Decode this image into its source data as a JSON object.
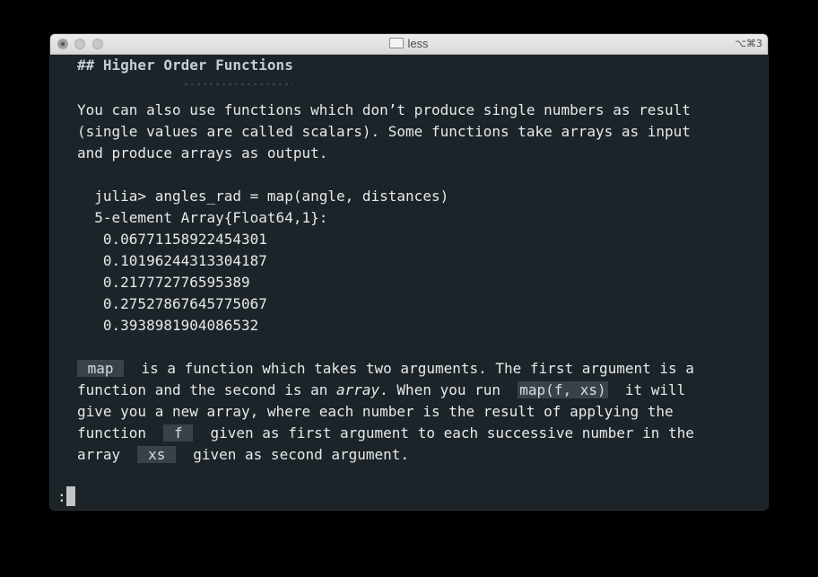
{
  "window": {
    "title": "less",
    "shortcut": "⌥⌘3"
  },
  "content": {
    "heading": "## Higher Order Functions",
    "para1_line1": "You can also use functions which don’t produce single numbers as result",
    "para1_line2": "(single values are called scalars). Some functions take arrays as input",
    "para1_line3": "and produce arrays as output.",
    "code_line1": "  julia> angles_rad = map(angle, distances)",
    "code_line2": "  5-element Array{Float64,1}:",
    "code_values": [
      "   0.06771158922454301",
      "   0.10196244313304187",
      "   0.217772776595389",
      "   0.27527867645775067",
      "   0.3938981904086532"
    ],
    "para2": {
      "l1_code": " map ",
      "l1_text": "  is a function which takes two arguments. The first argument is a",
      "l2_text_a": "function and the second is an ",
      "l2_em": "array",
      "l2_text_b": ". When you run  ",
      "l2_code": "map(f, xs)",
      "l2_text_c": "  it will",
      "l3_text": "give you a new array, where each number is the result of applying the",
      "l4_text_a": "function  ",
      "l4_code": " f ",
      "l4_text_b": "  given as first argument to each successive number in the",
      "l5_text_a": "array  ",
      "l5_code": " xs ",
      "l5_text_b": "  given as second argument."
    },
    "prompt": ":"
  },
  "colors": {
    "background": "#1c2429",
    "text": "#e6e9ea",
    "inline_code_bg": "#3a4248"
  }
}
